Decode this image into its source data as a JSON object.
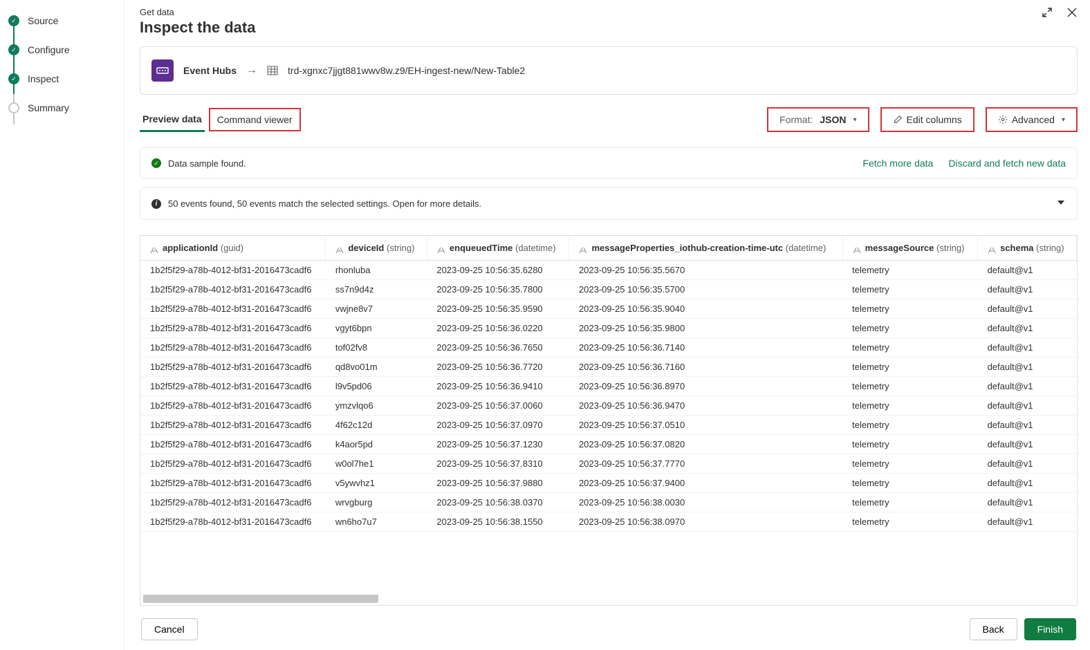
{
  "stepper": {
    "steps": [
      {
        "label": "Source",
        "state": "done"
      },
      {
        "label": "Configure",
        "state": "done"
      },
      {
        "label": "Inspect",
        "state": "done"
      },
      {
        "label": "Summary",
        "state": "pending"
      }
    ]
  },
  "header": {
    "subtitle": "Get data",
    "title": "Inspect the data"
  },
  "breadcrumb": {
    "connector": "Event Hubs",
    "path": "trd-xgnxc7jjgt881wwv8w.z9/EH-ingest-new/New-Table2"
  },
  "tabs": {
    "preview": "Preview data",
    "command": "Command viewer"
  },
  "toolbar": {
    "format_label": "Format:",
    "format_value": "JSON",
    "edit_columns": "Edit columns",
    "advanced": "Advanced"
  },
  "status": {
    "sample_found": "Data sample found.",
    "fetch_more": "Fetch more data",
    "discard": "Discard and fetch new data",
    "events_msg": "50 events found, 50 events match the selected settings. Open for more details."
  },
  "table": {
    "columns": [
      {
        "name": "applicationId",
        "type": "(guid)"
      },
      {
        "name": "deviceId",
        "type": "(string)"
      },
      {
        "name": "enqueuedTime",
        "type": "(datetime)"
      },
      {
        "name": "messageProperties_iothub-creation-time-utc",
        "type": "(datetime)"
      },
      {
        "name": "messageSource",
        "type": "(string)"
      },
      {
        "name": "schema",
        "type": "(string)"
      }
    ],
    "rows": [
      [
        "1b2f5f29-a78b-4012-bf31-2016473cadf6",
        "rhonluba",
        "2023-09-25 10:56:35.6280",
        "2023-09-25 10:56:35.5670",
        "telemetry",
        "default@v1"
      ],
      [
        "1b2f5f29-a78b-4012-bf31-2016473cadf6",
        "ss7n9d4z",
        "2023-09-25 10:56:35.7800",
        "2023-09-25 10:56:35.5700",
        "telemetry",
        "default@v1"
      ],
      [
        "1b2f5f29-a78b-4012-bf31-2016473cadf6",
        "vwjne8v7",
        "2023-09-25 10:56:35.9590",
        "2023-09-25 10:56:35.9040",
        "telemetry",
        "default@v1"
      ],
      [
        "1b2f5f29-a78b-4012-bf31-2016473cadf6",
        "vgyt6bpn",
        "2023-09-25 10:56:36.0220",
        "2023-09-25 10:56:35.9800",
        "telemetry",
        "default@v1"
      ],
      [
        "1b2f5f29-a78b-4012-bf31-2016473cadf6",
        "tof02fv8",
        "2023-09-25 10:56:36.7650",
        "2023-09-25 10:56:36.7140",
        "telemetry",
        "default@v1"
      ],
      [
        "1b2f5f29-a78b-4012-bf31-2016473cadf6",
        "qd8vo01m",
        "2023-09-25 10:56:36.7720",
        "2023-09-25 10:56:36.7160",
        "telemetry",
        "default@v1"
      ],
      [
        "1b2f5f29-a78b-4012-bf31-2016473cadf6",
        "l9v5pd06",
        "2023-09-25 10:56:36.9410",
        "2023-09-25 10:56:36.8970",
        "telemetry",
        "default@v1"
      ],
      [
        "1b2f5f29-a78b-4012-bf31-2016473cadf6",
        "ymzvlqo6",
        "2023-09-25 10:56:37.0060",
        "2023-09-25 10:56:36.9470",
        "telemetry",
        "default@v1"
      ],
      [
        "1b2f5f29-a78b-4012-bf31-2016473cadf6",
        "4f62c12d",
        "2023-09-25 10:56:37.0970",
        "2023-09-25 10:56:37.0510",
        "telemetry",
        "default@v1"
      ],
      [
        "1b2f5f29-a78b-4012-bf31-2016473cadf6",
        "k4aor5pd",
        "2023-09-25 10:56:37.1230",
        "2023-09-25 10:56:37.0820",
        "telemetry",
        "default@v1"
      ],
      [
        "1b2f5f29-a78b-4012-bf31-2016473cadf6",
        "w0ol7he1",
        "2023-09-25 10:56:37.8310",
        "2023-09-25 10:56:37.7770",
        "telemetry",
        "default@v1"
      ],
      [
        "1b2f5f29-a78b-4012-bf31-2016473cadf6",
        "v5ywvhz1",
        "2023-09-25 10:56:37.9880",
        "2023-09-25 10:56:37.9400",
        "telemetry",
        "default@v1"
      ],
      [
        "1b2f5f29-a78b-4012-bf31-2016473cadf6",
        "wrvgburg",
        "2023-09-25 10:56:38.0370",
        "2023-09-25 10:56:38.0030",
        "telemetry",
        "default@v1"
      ],
      [
        "1b2f5f29-a78b-4012-bf31-2016473cadf6",
        "wn6ho7u7",
        "2023-09-25 10:56:38.1550",
        "2023-09-25 10:56:38.0970",
        "telemetry",
        "default@v1"
      ]
    ]
  },
  "footer": {
    "cancel": "Cancel",
    "back": "Back",
    "finish": "Finish"
  }
}
